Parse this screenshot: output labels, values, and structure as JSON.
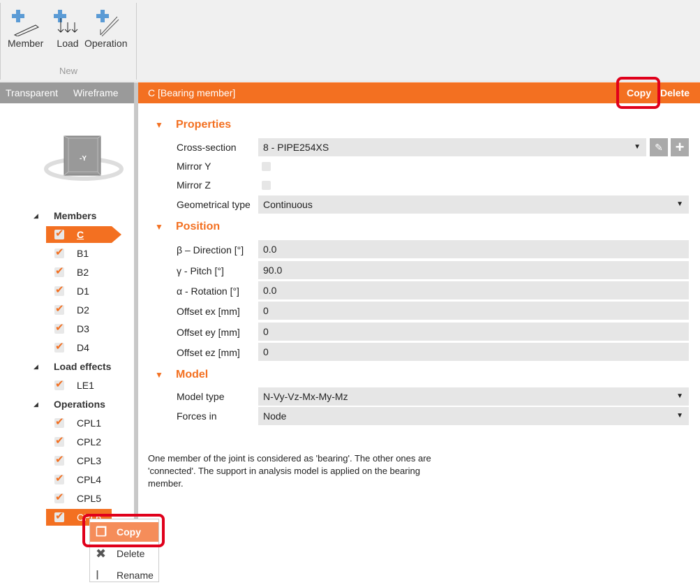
{
  "ribbon": {
    "buttons": [
      {
        "label": "Member",
        "icon": "add-member-icon"
      },
      {
        "label": "Load",
        "icon": "add-load-icon"
      },
      {
        "label": "Operation",
        "icon": "add-operation-icon"
      }
    ],
    "group_label": "New"
  },
  "view": {
    "transparent": "Transparent",
    "wireframe": "Wireframe",
    "cube_label": "-Y"
  },
  "header": {
    "title": "C  [Bearing member]",
    "copy": "Copy",
    "delete": "Delete",
    "color": "#f37021"
  },
  "tree": {
    "members_label": "Members",
    "members": [
      "C",
      "B1",
      "B2",
      "D1",
      "D2",
      "D3",
      "D4"
    ],
    "load_label": "Load effects",
    "loads": [
      "LE1"
    ],
    "ops_label": "Operations",
    "ops": [
      "CPL1",
      "CPL2",
      "CPL3",
      "CPL4",
      "CPL5",
      "CPL6"
    ]
  },
  "properties": {
    "title": "Properties",
    "cross_section_label": "Cross-section",
    "cross_section": "8 - PIPE254XS",
    "mirror_y": "Mirror Y",
    "mirror_z": "Mirror Z",
    "geo_label": "Geometrical type",
    "geo": "Continuous"
  },
  "position": {
    "title": "Position",
    "rows": [
      {
        "label": "β – Direction [°]",
        "value": "0.0"
      },
      {
        "label": "γ - Pitch [°]",
        "value": "90.0"
      },
      {
        "label": "α - Rotation [°]",
        "value": "0.0"
      },
      {
        "label": "Offset ex [mm]",
        "value": "0"
      },
      {
        "label": "Offset ey [mm]",
        "value": "0"
      },
      {
        "label": "Offset ez [mm]",
        "value": "0"
      }
    ]
  },
  "model": {
    "title": "Model",
    "type_label": "Model type",
    "type": "N-Vy-Vz-Mx-My-Mz",
    "forces_label": "Forces in",
    "forces": "Node"
  },
  "note": "One member of the joint is considered as 'bearing'. The other ones are 'connected'. The support in analysis model is applied on the bearing member.",
  "context_menu": {
    "items": [
      "Copy",
      "Delete",
      "Rename"
    ]
  }
}
